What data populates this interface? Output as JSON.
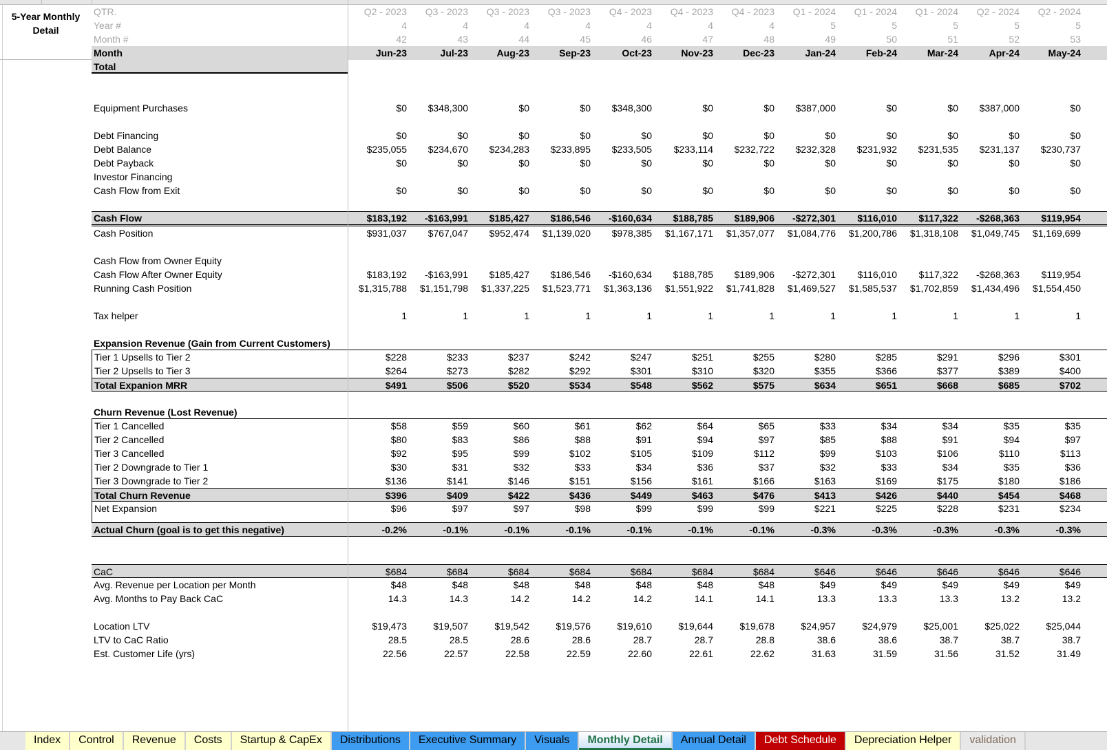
{
  "title": "5-Year Monthly Detail",
  "header": {
    "qtr_label": "QTR.",
    "year_label": "Year #",
    "month_num_label": "Month #",
    "month_label": "Month",
    "quarters": [
      "Q2 - 2023",
      "Q3 - 2023",
      "Q3 - 2023",
      "Q3 - 2023",
      "Q4 - 2023",
      "Q4 - 2023",
      "Q4 - 2023",
      "Q1 - 2024",
      "Q1 - 2024",
      "Q1 - 2024",
      "Q2 - 2024",
      "Q2 - 2024"
    ],
    "years": [
      "4",
      "4",
      "4",
      "4",
      "4",
      "4",
      "4",
      "5",
      "5",
      "5",
      "5",
      "5"
    ],
    "month_nums": [
      "42",
      "43",
      "44",
      "45",
      "46",
      "47",
      "48",
      "49",
      "50",
      "51",
      "52",
      "53"
    ],
    "months": [
      "Jun-23",
      "Jul-23",
      "Aug-23",
      "Sep-23",
      "Oct-23",
      "Nov-23",
      "Dec-23",
      "Jan-24",
      "Feb-24",
      "Mar-24",
      "Apr-24",
      "May-24"
    ]
  },
  "rows": [
    {
      "label": "Total",
      "kind": "totalrow",
      "values": []
    },
    {
      "label": "",
      "kind": "blank",
      "values": []
    },
    {
      "label": "",
      "kind": "blank",
      "values": []
    },
    {
      "label": "Equipment Purchases",
      "kind": "item",
      "values": [
        "$0",
        "$348,300",
        "$0",
        "$0",
        "$348,300",
        "$0",
        "$0",
        "$387,000",
        "$0",
        "$0",
        "$387,000",
        "$0"
      ]
    },
    {
      "label": "",
      "kind": "blank",
      "values": []
    },
    {
      "label": "Debt Financing",
      "kind": "item",
      "values": [
        "$0",
        "$0",
        "$0",
        "$0",
        "$0",
        "$0",
        "$0",
        "$0",
        "$0",
        "$0",
        "$0",
        "$0"
      ]
    },
    {
      "label": "Debt Balance",
      "kind": "item",
      "values": [
        "$235,055",
        "$234,670",
        "$234,283",
        "$233,895",
        "$233,505",
        "$233,114",
        "$232,722",
        "$232,328",
        "$231,932",
        "$231,535",
        "$231,137",
        "$230,737"
      ]
    },
    {
      "label": "Debt Payback",
      "kind": "item",
      "values": [
        "$0",
        "$0",
        "$0",
        "$0",
        "$0",
        "$0",
        "$0",
        "$0",
        "$0",
        "$0",
        "$0",
        "$0"
      ]
    },
    {
      "label": "Investor Financing",
      "kind": "item",
      "values": []
    },
    {
      "label": "Cash Flow from Exit",
      "kind": "item",
      "values": [
        "$0",
        "$0",
        "$0",
        "$0",
        "$0",
        "$0",
        "$0",
        "$0",
        "$0",
        "$0",
        "$0",
        "$0"
      ]
    },
    {
      "label": "",
      "kind": "blank",
      "values": []
    },
    {
      "label": "Cash Flow",
      "kind": "cashflow",
      "values": [
        "$183,192",
        "-$163,991",
        "$185,427",
        "$186,546",
        "-$160,634",
        "$188,785",
        "$189,906",
        "-$272,301",
        "$116,010",
        "$117,322",
        "-$268,363",
        "$119,954"
      ]
    },
    {
      "label": "Cash Position",
      "kind": "item",
      "values": [
        "$931,037",
        "$767,047",
        "$952,474",
        "$1,139,020",
        "$978,385",
        "$1,167,171",
        "$1,357,077",
        "$1,084,776",
        "$1,200,786",
        "$1,318,108",
        "$1,049,745",
        "$1,169,699"
      ]
    },
    {
      "label": "",
      "kind": "blank",
      "values": []
    },
    {
      "label": "Cash Flow from Owner Equity",
      "kind": "item",
      "values": []
    },
    {
      "label": "Cash Flow After Owner Equity",
      "kind": "item",
      "values": [
        "$183,192",
        "-$163,991",
        "$185,427",
        "$186,546",
        "-$160,634",
        "$188,785",
        "$189,906",
        "-$272,301",
        "$116,010",
        "$117,322",
        "-$268,363",
        "$119,954"
      ]
    },
    {
      "label": "Running Cash Position",
      "kind": "item",
      "values": [
        "$1,315,788",
        "$1,151,798",
        "$1,337,225",
        "$1,523,771",
        "$1,363,136",
        "$1,551,922",
        "$1,741,828",
        "$1,469,527",
        "$1,585,537",
        "$1,702,859",
        "$1,434,496",
        "$1,554,450"
      ]
    },
    {
      "label": "",
      "kind": "blank",
      "values": []
    },
    {
      "label": "Tax helper",
      "kind": "item",
      "values": [
        "1",
        "1",
        "1",
        "1",
        "1",
        "1",
        "1",
        "1",
        "1",
        "1",
        "1",
        "1"
      ]
    },
    {
      "label": "",
      "kind": "blank",
      "values": []
    },
    {
      "label": "Expansion Revenue (Gain from Current Customers)",
      "kind": "section",
      "values": []
    },
    {
      "label": "Tier 1 Upsells to Tier 2",
      "kind": "boxed",
      "values": [
        "$228",
        "$233",
        "$237",
        "$242",
        "$247",
        "$251",
        "$255",
        "$280",
        "$285",
        "$291",
        "$296",
        "$301"
      ]
    },
    {
      "label": "Tier 2 Upsells to Tier 3",
      "kind": "boxed",
      "values": [
        "$264",
        "$273",
        "$282",
        "$292",
        "$301",
        "$310",
        "$320",
        "$355",
        "$366",
        "$377",
        "$389",
        "$400"
      ]
    },
    {
      "label": "Total Expanion MRR",
      "kind": "boxtotal",
      "values": [
        "$491",
        "$506",
        "$520",
        "$534",
        "$548",
        "$562",
        "$575",
        "$634",
        "$651",
        "$668",
        "$685",
        "$702"
      ]
    },
    {
      "label": "",
      "kind": "blank",
      "values": []
    },
    {
      "label": "Churn Revenue (Lost Revenue)",
      "kind": "section",
      "values": []
    },
    {
      "label": "Tier 1 Cancelled",
      "kind": "boxed",
      "values": [
        "$58",
        "$59",
        "$60",
        "$61",
        "$62",
        "$64",
        "$65",
        "$33",
        "$34",
        "$34",
        "$35",
        "$35"
      ]
    },
    {
      "label": "Tier 2 Cancelled",
      "kind": "boxed",
      "values": [
        "$80",
        "$83",
        "$86",
        "$88",
        "$91",
        "$94",
        "$97",
        "$85",
        "$88",
        "$91",
        "$94",
        "$97"
      ]
    },
    {
      "label": "Tier 3 Cancelled",
      "kind": "boxed",
      "values": [
        "$92",
        "$95",
        "$99",
        "$102",
        "$105",
        "$109",
        "$112",
        "$99",
        "$103",
        "$106",
        "$110",
        "$113"
      ]
    },
    {
      "label": "Tier 2 Downgrade to Tier 1",
      "kind": "boxed",
      "values": [
        "$30",
        "$31",
        "$32",
        "$33",
        "$34",
        "$36",
        "$37",
        "$32",
        "$33",
        "$34",
        "$35",
        "$36"
      ]
    },
    {
      "label": "Tier 3 Downgrade to Tier 2",
      "kind": "boxed",
      "values": [
        "$136",
        "$141",
        "$146",
        "$151",
        "$156",
        "$161",
        "$166",
        "$163",
        "$169",
        "$175",
        "$180",
        "$186"
      ]
    },
    {
      "label": "Total Churn Revenue",
      "kind": "boxtotal",
      "values": [
        "$396",
        "$409",
        "$422",
        "$436",
        "$449",
        "$463",
        "$476",
        "$413",
        "$426",
        "$440",
        "$454",
        "$468"
      ]
    },
    {
      "label": "Net Expansion",
      "kind": "net",
      "values": [
        "$96",
        "$97",
        "$97",
        "$98",
        "$99",
        "$99",
        "$99",
        "$221",
        "$225",
        "$228",
        "$231",
        "$234"
      ]
    },
    {
      "label": "Actual Churn (goal is to get this negative)",
      "kind": "churn",
      "values": [
        "-0.2%",
        "-0.1%",
        "-0.1%",
        "-0.1%",
        "-0.1%",
        "-0.1%",
        "-0.1%",
        "-0.3%",
        "-0.3%",
        "-0.3%",
        "-0.3%",
        "-0.3%"
      ]
    },
    {
      "label": "",
      "kind": "blank",
      "values": []
    },
    {
      "label": "",
      "kind": "blank",
      "values": []
    },
    {
      "label": "CaC",
      "kind": "cac",
      "values": [
        "$684",
        "$684",
        "$684",
        "$684",
        "$684",
        "$684",
        "$684",
        "$646",
        "$646",
        "$646",
        "$646",
        "$646"
      ]
    },
    {
      "label": "Avg. Revenue per Location per Month",
      "kind": "item",
      "values": [
        "$48",
        "$48",
        "$48",
        "$48",
        "$48",
        "$48",
        "$48",
        "$49",
        "$49",
        "$49",
        "$49",
        "$49"
      ]
    },
    {
      "label": "Avg. Months to Pay Back CaC",
      "kind": "item",
      "values": [
        "14.3",
        "14.3",
        "14.2",
        "14.2",
        "14.2",
        "14.1",
        "14.1",
        "13.3",
        "13.3",
        "13.3",
        "13.2",
        "13.2"
      ]
    },
    {
      "label": "",
      "kind": "blank",
      "values": []
    },
    {
      "label": "Location LTV",
      "kind": "item",
      "values": [
        "$19,473",
        "$19,507",
        "$19,542",
        "$19,576",
        "$19,610",
        "$19,644",
        "$19,678",
        "$24,957",
        "$24,979",
        "$25,001",
        "$25,022",
        "$25,044"
      ]
    },
    {
      "label": "LTV to CaC Ratio",
      "kind": "item",
      "values": [
        "28.5",
        "28.5",
        "28.6",
        "28.6",
        "28.7",
        "28.7",
        "28.8",
        "38.6",
        "38.6",
        "38.7",
        "38.7",
        "38.7"
      ]
    },
    {
      "label": "Est. Customer Life (yrs)",
      "kind": "item",
      "values": [
        "22.56",
        "22.57",
        "22.58",
        "22.59",
        "22.60",
        "22.61",
        "22.62",
        "31.63",
        "31.59",
        "31.56",
        "31.52",
        "31.49"
      ]
    }
  ],
  "tabs": [
    {
      "label": "Index",
      "bg": "#ffffcc",
      "fg": "#000000"
    },
    {
      "label": "Control",
      "bg": "#ffffcc",
      "fg": "#000000"
    },
    {
      "label": "Revenue",
      "bg": "#ffffcc",
      "fg": "#000000"
    },
    {
      "label": "Costs",
      "bg": "#ffffcc",
      "fg": "#000000"
    },
    {
      "label": "Startup & CapEx",
      "bg": "#ffffcc",
      "fg": "#000000"
    },
    {
      "label": "Distributions",
      "bg": "#3d9bf0",
      "fg": "#000000"
    },
    {
      "label": "Executive Summary",
      "bg": "#3d9bf0",
      "fg": "#000000"
    },
    {
      "label": "Visuals",
      "bg": "#3d9bf0",
      "fg": "#000000"
    },
    {
      "label": "Monthly Detail",
      "bg": "#ffffff",
      "fg": "#217346",
      "active": true
    },
    {
      "label": "Annual Detail",
      "bg": "#3d9bf0",
      "fg": "#000000"
    },
    {
      "label": "Debt Schedule",
      "bg": "#c00000",
      "fg": "#ffffff"
    },
    {
      "label": "Depreciation Helper",
      "bg": "#ffffcc",
      "fg": "#000000"
    },
    {
      "label": "validation",
      "bg": "#e8e8e8",
      "fg": "#7f6a5a"
    }
  ]
}
